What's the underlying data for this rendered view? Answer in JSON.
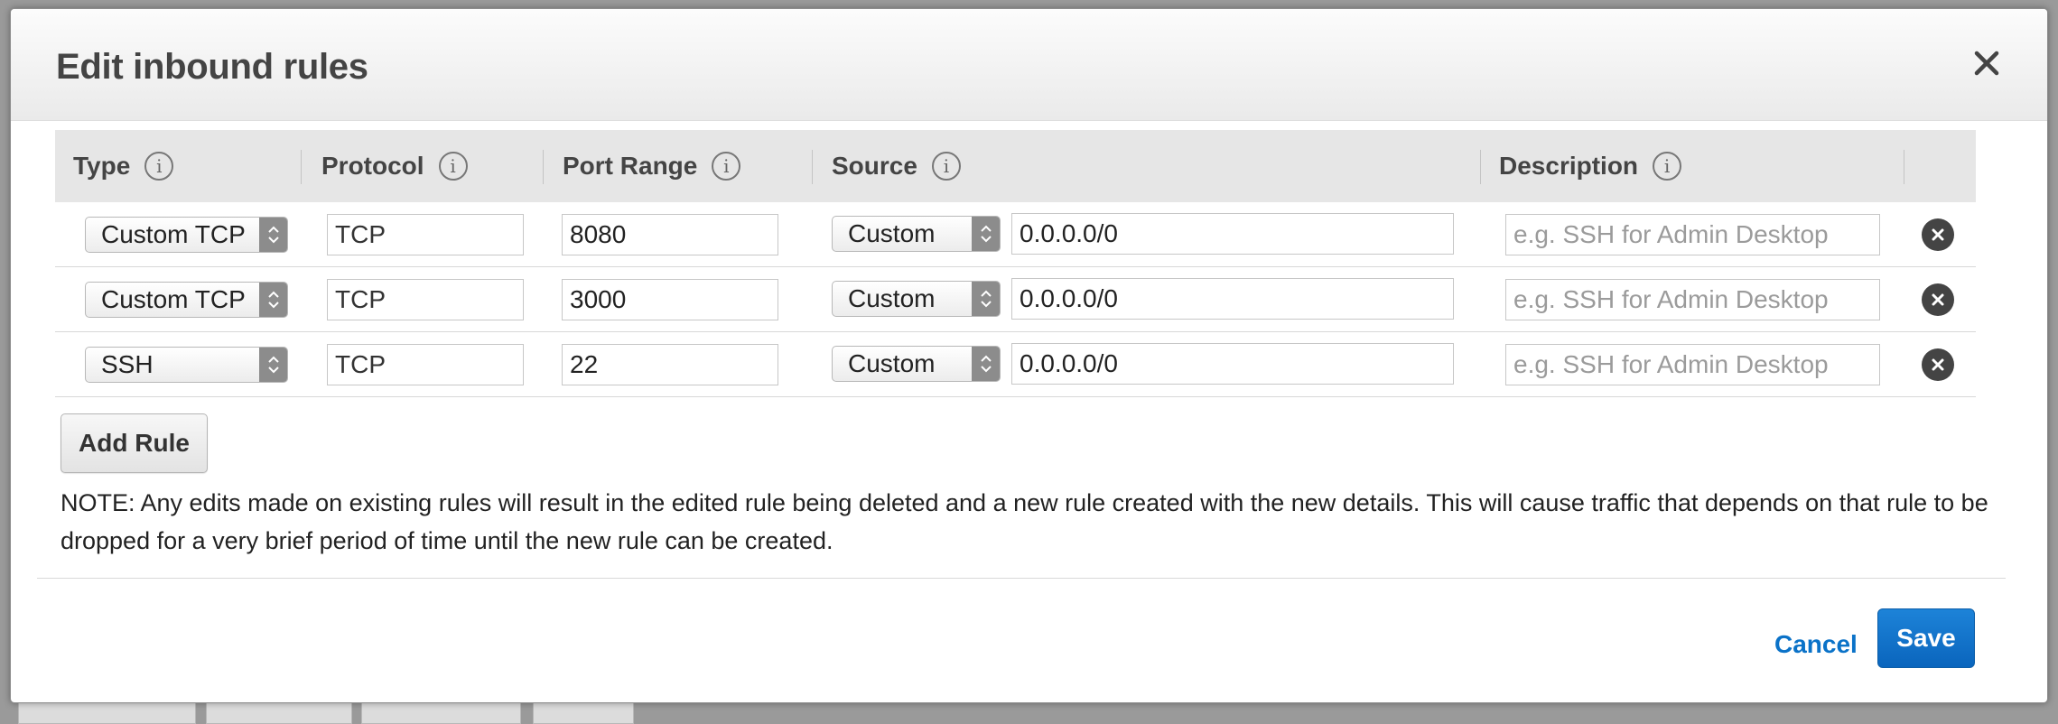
{
  "dialog": {
    "title": "Edit inbound rules"
  },
  "table": {
    "headers": {
      "type": "Type",
      "protocol": "Protocol",
      "port_range": "Port Range",
      "source": "Source",
      "description": "Description"
    },
    "rows": [
      {
        "type": "Custom TCP",
        "protocol": "TCP",
        "port_range": "8080",
        "source_type": "Custom",
        "source_cidr": "0.0.0.0/0",
        "description_placeholder": "e.g. SSH for Admin Desktop"
      },
      {
        "type": "Custom TCP",
        "protocol": "TCP",
        "port_range": "3000",
        "source_type": "Custom",
        "source_cidr": "0.0.0.0/0",
        "description_placeholder": "e.g. SSH for Admin Desktop"
      },
      {
        "type": "SSH",
        "protocol": "TCP",
        "port_range": "22",
        "source_type": "Custom",
        "source_cidr": "0.0.0.0/0",
        "description_placeholder": "e.g. SSH for Admin Desktop"
      }
    ]
  },
  "add_rule_label": "Add Rule",
  "note": "NOTE: Any edits made on existing rules will result in the edited rule being deleted and a new rule created with the new details. This will cause traffic that depends on that rule to be dropped for a very brief period of time until the new rule can be created.",
  "footer": {
    "cancel_label": "Cancel",
    "save_label": "Save"
  },
  "colors": {
    "primary_button": "#0a65bd",
    "link": "#0a72c8",
    "header_bg": "#e6e6e6"
  }
}
